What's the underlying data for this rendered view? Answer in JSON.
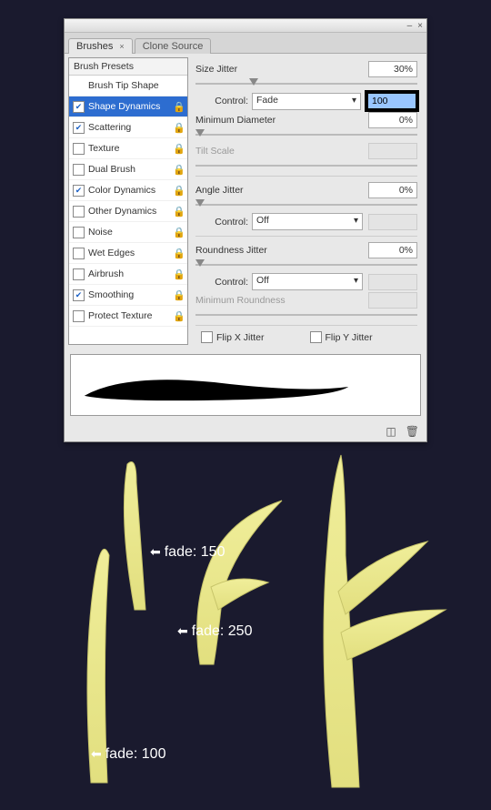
{
  "tabs": {
    "active": "Brushes",
    "inactive": "Clone Source"
  },
  "sidebar": {
    "presets_label": "Brush Presets",
    "items": [
      {
        "label": "Brush Tip Shape",
        "checkbox": false,
        "checked": false,
        "lock": false,
        "selected": false
      },
      {
        "label": "Shape Dynamics",
        "checkbox": true,
        "checked": true,
        "lock": true,
        "selected": true
      },
      {
        "label": "Scattering",
        "checkbox": true,
        "checked": true,
        "lock": true,
        "selected": false
      },
      {
        "label": "Texture",
        "checkbox": true,
        "checked": false,
        "lock": true,
        "selected": false
      },
      {
        "label": "Dual Brush",
        "checkbox": true,
        "checked": false,
        "lock": true,
        "selected": false
      },
      {
        "label": "Color Dynamics",
        "checkbox": true,
        "checked": true,
        "lock": true,
        "selected": false
      },
      {
        "label": "Other Dynamics",
        "checkbox": true,
        "checked": false,
        "lock": true,
        "selected": false
      },
      {
        "label": "Noise",
        "checkbox": true,
        "checked": false,
        "lock": true,
        "selected": false
      },
      {
        "label": "Wet Edges",
        "checkbox": true,
        "checked": false,
        "lock": true,
        "selected": false
      },
      {
        "label": "Airbrush",
        "checkbox": true,
        "checked": false,
        "lock": true,
        "selected": false
      },
      {
        "label": "Smoothing",
        "checkbox": true,
        "checked": true,
        "lock": true,
        "selected": false
      },
      {
        "label": "Protect Texture",
        "checkbox": true,
        "checked": false,
        "lock": true,
        "selected": false
      }
    ]
  },
  "controls": {
    "size_jitter_label": "Size Jitter",
    "size_jitter_value": "30%",
    "control_label": "Control:",
    "size_control_value": "Fade",
    "size_fade_input": "100",
    "min_diameter_label": "Minimum Diameter",
    "min_diameter_value": "0%",
    "tilt_scale_label": "Tilt Scale",
    "angle_jitter_label": "Angle Jitter",
    "angle_jitter_value": "0%",
    "angle_control_value": "Off",
    "roundness_jitter_label": "Roundness Jitter",
    "roundness_jitter_value": "0%",
    "roundness_control_value": "Off",
    "min_roundness_label": "Minimum Roundness",
    "flipx_label": "Flip X Jitter",
    "flipy_label": "Flip Y Jitter"
  },
  "annotations": {
    "a1": "fade: 150",
    "a2": "fade: 250",
    "a3": "fade: 100"
  }
}
